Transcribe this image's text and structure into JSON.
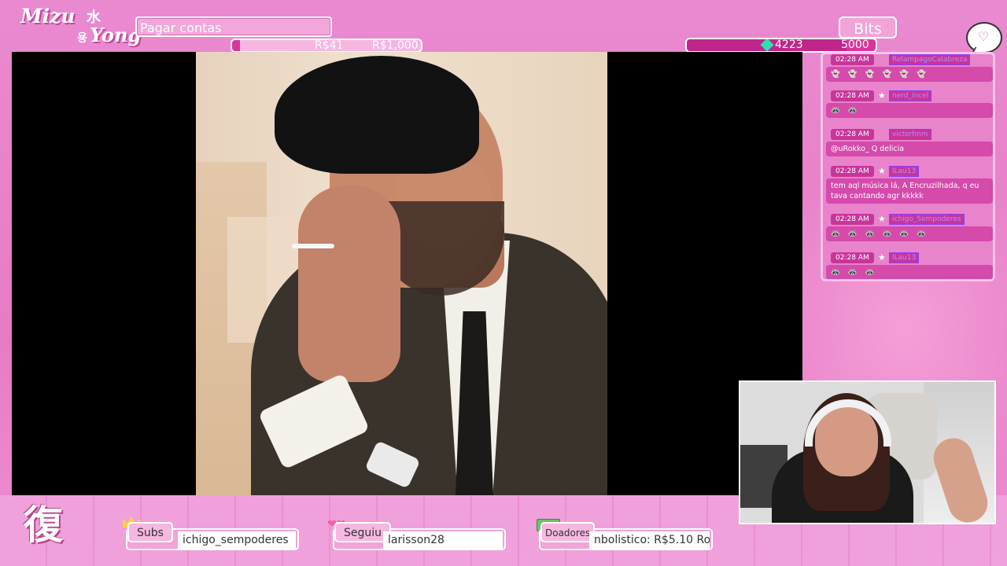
{
  "branding": {
    "logo_top": "Mizu",
    "logo_kanji": "水",
    "logo_hangul": "용",
    "logo_bottom": "Yong",
    "bottom_kanji": "復"
  },
  "goal": {
    "title": "Pagar contas",
    "current": "R$41",
    "target": "R$1,000",
    "progress": 0.041
  },
  "bits": {
    "label": "Bits",
    "current": "4223",
    "target": "5000",
    "progress": 0.8446
  },
  "chat": {
    "messages": [
      {
        "time": "02:28 AM",
        "user": "RelampagoCalabreza",
        "text": "",
        "emotes": "👻👻👻👻👻👻",
        "badge": false
      },
      {
        "time": "02:28 AM",
        "user": "nerd_incel",
        "text": "",
        "emotes": "🦝🦝",
        "badge": true
      },
      {
        "time": "02:28 AM",
        "user": "victorhnm",
        "text": "@uRokko_ Q delicia",
        "emotes": "",
        "badge": false
      },
      {
        "time": "02:28 AM",
        "user": "lLau13",
        "text": "tem aql música lá, A Encruzilhada, q eu tava cantando agr kkkkk",
        "emotes": "",
        "badge": true
      },
      {
        "time": "02:28 AM",
        "user": "ichigo_Sempoderes",
        "text": "",
        "emotes": "🦝🦝🦝🦝🦝🦝",
        "badge": true
      },
      {
        "time": "02:28 AM",
        "user": "lLau13",
        "text": "",
        "emotes": "🦝🦝🦝",
        "badge": true
      }
    ]
  },
  "bottom": {
    "subs_label": "Subs",
    "subs_value": "ichigo_sempoderes",
    "follow_label": "Seguiu",
    "follow_value": "larisson28",
    "donors_label": "Doadores",
    "donors_value": "nbolistico: R$5.10    Ro"
  },
  "colors": {
    "frame": "#e77bc6",
    "accent": "#d8359c",
    "panel": "#f2a3d8"
  }
}
